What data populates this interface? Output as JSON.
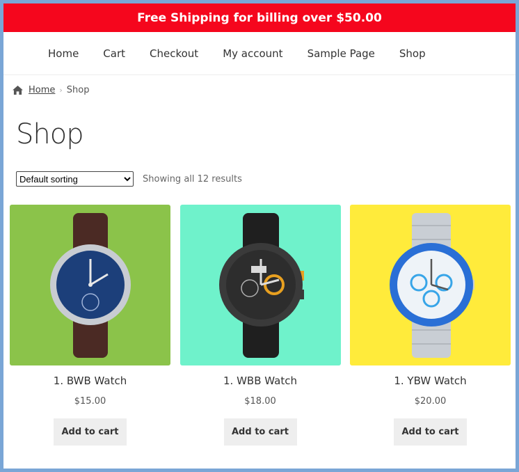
{
  "promo": {
    "text": "Free Shipping for billing over $50.00"
  },
  "nav": {
    "items": [
      "Home",
      "Cart",
      "Checkout",
      "My account",
      "Sample Page",
      "Shop"
    ]
  },
  "breadcrumb": {
    "home": "Home",
    "current": "Shop"
  },
  "page": {
    "title": "Shop"
  },
  "sorting": {
    "selected": "Default sorting"
  },
  "results": {
    "text": "Showing all 12 results"
  },
  "products": [
    {
      "title": "1. BWB Watch",
      "price": "$15.00",
      "button": "Add to cart",
      "bg": "#8bc34a",
      "dial": "#1c3f7a",
      "strap": "#4b2a24",
      "case": "#c8ccd2"
    },
    {
      "title": "1. WBB Watch",
      "price": "$18.00",
      "button": "Add to cart",
      "bg": "#6ff2cb",
      "dial": "#2d2d2d",
      "strap": "#1f1f1f",
      "case": "#3a3a3a"
    },
    {
      "title": "1. YBW Watch",
      "price": "$20.00",
      "button": "Add to cart",
      "bg": "#ffeb3b",
      "dial": "#eef3f8",
      "strap": "#c9ced4",
      "case": "#2a6fd6"
    }
  ],
  "colors": {
    "promo_bg": "#f5061d",
    "page_bg": "#7aa6d6"
  },
  "icons": {
    "home": "home-icon",
    "separator": "chevron-right-icon"
  }
}
